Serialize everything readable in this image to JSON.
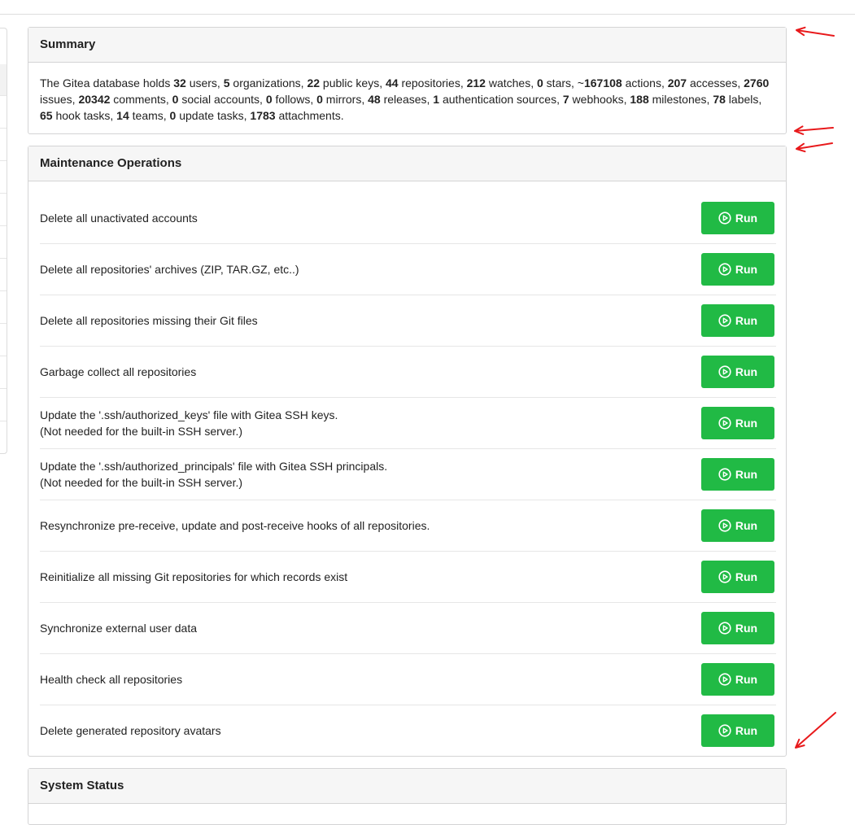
{
  "summary": {
    "title": "Summary",
    "parts": [
      {
        "t": "The Gitea database holds "
      },
      {
        "b": "32"
      },
      {
        "t": " users, "
      },
      {
        "b": "5"
      },
      {
        "t": " organizations, "
      },
      {
        "b": "22"
      },
      {
        "t": " public keys, "
      },
      {
        "b": "44"
      },
      {
        "t": " repositories, "
      },
      {
        "b": "212"
      },
      {
        "t": " watches, "
      },
      {
        "b": "0"
      },
      {
        "t": " stars, ~"
      },
      {
        "b": "167108"
      },
      {
        "t": " actions, "
      },
      {
        "b": "207"
      },
      {
        "t": " accesses, "
      },
      {
        "b": "2760"
      },
      {
        "t": " issues, "
      },
      {
        "b": "20342"
      },
      {
        "t": " comments, "
      },
      {
        "b": "0"
      },
      {
        "t": " social accounts, "
      },
      {
        "b": "0"
      },
      {
        "t": " follows, "
      },
      {
        "b": "0"
      },
      {
        "t": " mirrors, "
      },
      {
        "b": "48"
      },
      {
        "t": " releases, "
      },
      {
        "b": "1"
      },
      {
        "t": " authentication sources, "
      },
      {
        "b": "7"
      },
      {
        "t": " webhooks, "
      },
      {
        "b": "188"
      },
      {
        "t": " milestones, "
      },
      {
        "b": "78"
      },
      {
        "t": " labels, "
      },
      {
        "b": "65"
      },
      {
        "t": " hook tasks, "
      },
      {
        "b": "14"
      },
      {
        "t": " teams, "
      },
      {
        "b": "0"
      },
      {
        "t": " update tasks, "
      },
      {
        "b": "1783"
      },
      {
        "t": " attachments."
      }
    ]
  },
  "maintenance": {
    "title": "Maintenance Operations",
    "run_label": "Run",
    "operations": [
      {
        "line1": "Delete all unactivated accounts",
        "line2": ""
      },
      {
        "line1": "Delete all repositories' archives (ZIP, TAR.GZ, etc..)",
        "line2": ""
      },
      {
        "line1": "Delete all repositories missing their Git files",
        "line2": ""
      },
      {
        "line1": "Garbage collect all repositories",
        "line2": ""
      },
      {
        "line1": "Update the '.ssh/authorized_keys' file with Gitea SSH keys.",
        "line2": "(Not needed for the built-in SSH server.)"
      },
      {
        "line1": "Update the '.ssh/authorized_principals' file with Gitea SSH principals.",
        "line2": "(Not needed for the built-in SSH server.)"
      },
      {
        "line1": "Resynchronize pre-receive, update and post-receive hooks of all repositories.",
        "line2": ""
      },
      {
        "line1": "Reinitialize all missing Git repositories for which records exist",
        "line2": ""
      },
      {
        "line1": "Synchronize external user data",
        "line2": ""
      },
      {
        "line1": "Health check all repositories",
        "line2": ""
      },
      {
        "line1": "Delete generated repository avatars",
        "line2": ""
      }
    ]
  },
  "system_status": {
    "title": "System Status"
  },
  "colors": {
    "run_button": "#21ba45",
    "annotation_arrow": "#e8191b"
  },
  "icons": {
    "run": "play-circle-icon",
    "annotation": "red-arrow-icon"
  }
}
